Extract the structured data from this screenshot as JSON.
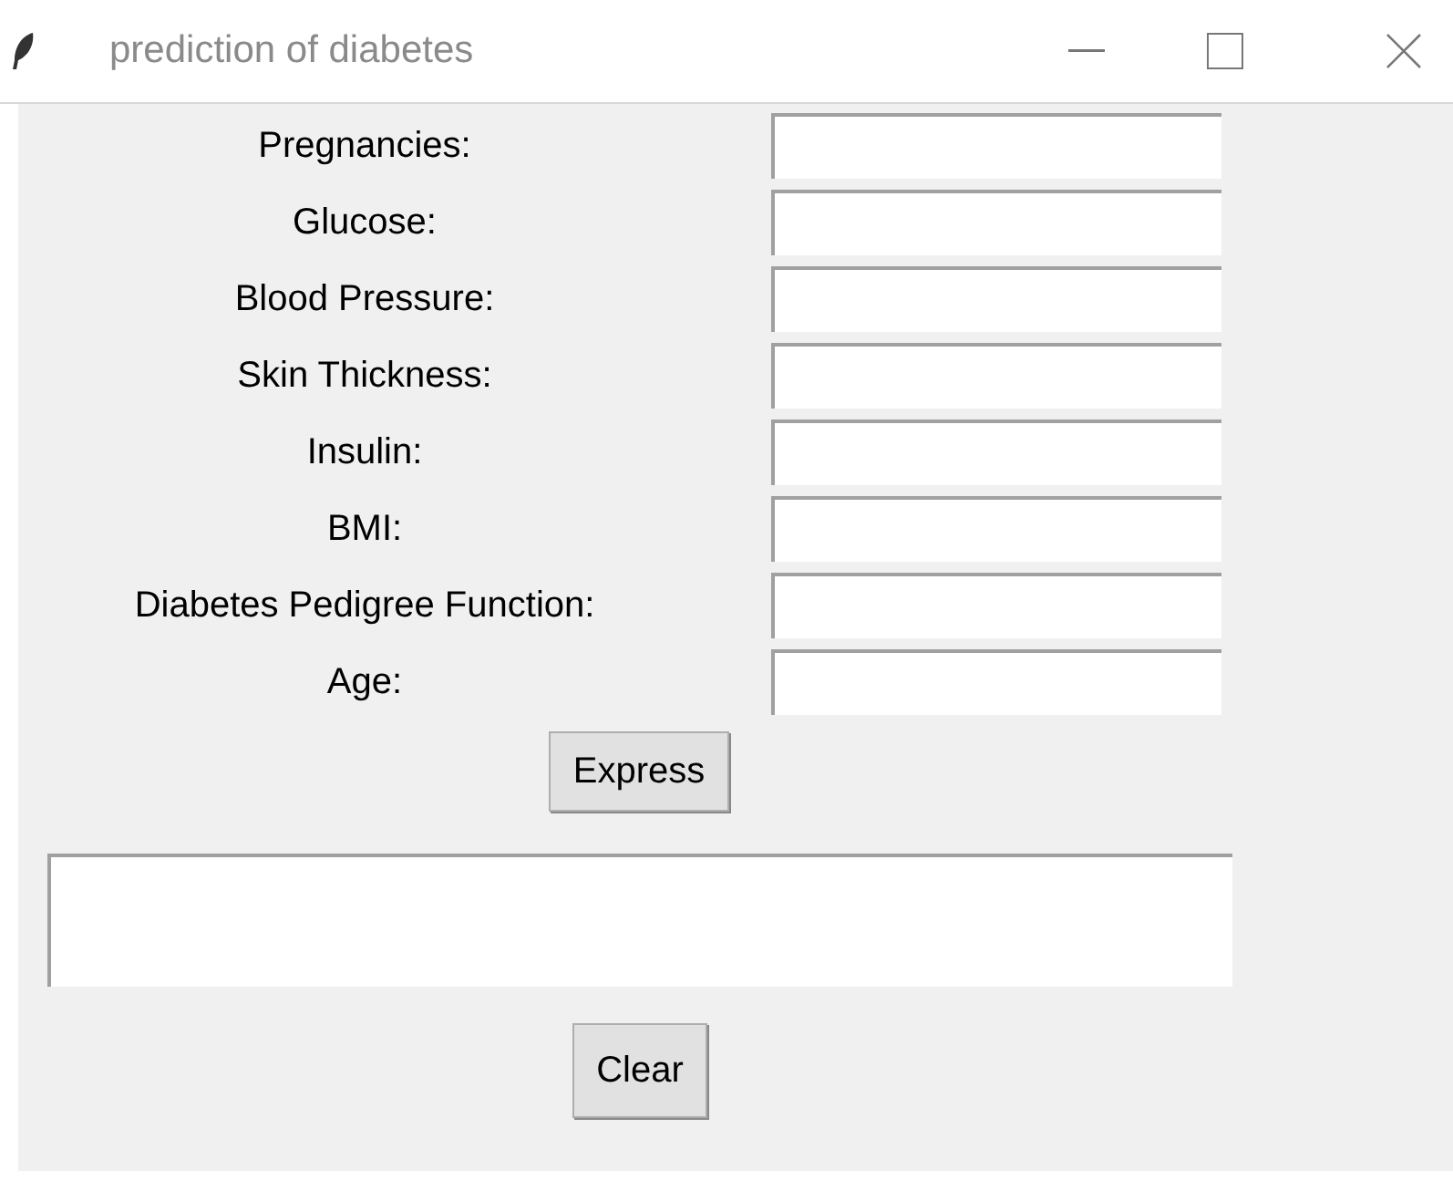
{
  "window": {
    "title": "prediction of diabetes"
  },
  "fields": [
    {
      "label": "Pregnancies:"
    },
    {
      "label": "Glucose:"
    },
    {
      "label": "Blood Pressure:"
    },
    {
      "label": "Skin Thickness:"
    },
    {
      "label": "Insulin:"
    },
    {
      "label": "BMI:"
    },
    {
      "label": "Diabetes Pedigree Function:"
    },
    {
      "label": "Age:"
    }
  ],
  "predict_button": "Express",
  "clear_button": "Clear"
}
